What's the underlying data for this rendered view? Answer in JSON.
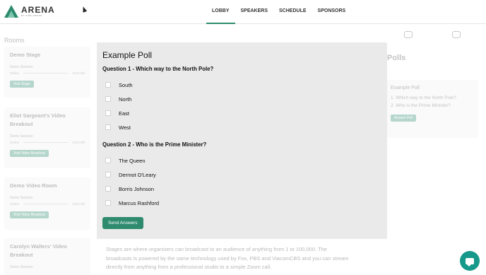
{
  "brand": {
    "name": "ARENA",
    "tagline": "BY FIRE GROUP",
    "color": "#2e8b6e"
  },
  "nav": [
    {
      "label": "LOBBY",
      "active": true
    },
    {
      "label": "SPEAKERS",
      "active": false
    },
    {
      "label": "SCHEDULE",
      "active": false
    },
    {
      "label": "SPONSORS",
      "active": false
    }
  ],
  "sidebar": {
    "title": "Rooms",
    "rooms": [
      {
        "name": "Demo Stage",
        "session": "Demo Session",
        "status": "Online",
        "time": "6 hrs left",
        "button": "Visit Stage"
      },
      {
        "name": "Eliot Sargeant's Video Breakout",
        "session": "Demo Session",
        "status": "Online",
        "time": "6 hrs left",
        "button": "Visit Video Breakout"
      },
      {
        "name": "Demo Video Room",
        "session": "Demo Session",
        "status": "Online",
        "time": "6 hrs left",
        "button": "Visit Video Breakout"
      },
      {
        "name": "Carolyn Walters' Video Breakout",
        "session": "Demo Session"
      }
    ]
  },
  "polls_panel": {
    "heading": "Polls",
    "card_title": "Example Poll",
    "questions": [
      "1. Which way to the North Pole?",
      "2. Who is the Prime Minister?"
    ],
    "button": "Answer Poll"
  },
  "stage_description": "Stages are where organisers can broadcast to an audience of anything from 1 to 100,000. The broadcasts is powered by the same technology used by Fox, PBS and ViacomCBS and you can stream directly from anything from a professional studio to a simple Zoom call.",
  "modal": {
    "title": "Example Poll",
    "questions": [
      {
        "text": "Question 1 - Which way to the North Pole?",
        "options": [
          "South",
          "North",
          "East",
          "West"
        ]
      },
      {
        "text": "Question 2 - Who is the Prime Minister?",
        "options": [
          "The Queen",
          "Dermot O'Leary",
          "Borris Johnson",
          "Marcus Rashford"
        ]
      }
    ],
    "submit_label": "Send Answers"
  },
  "icons": {
    "chat": "chat-bubble-icon",
    "checkbox": "checkbox-icon"
  }
}
